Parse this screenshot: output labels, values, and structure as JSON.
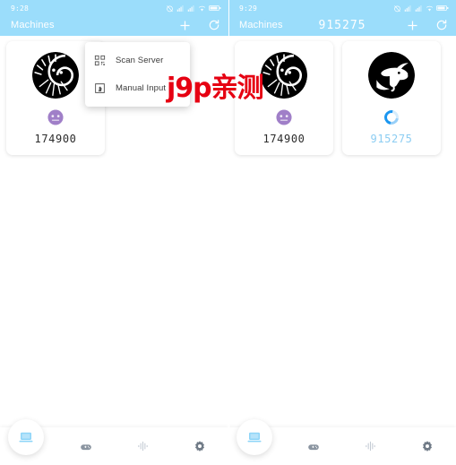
{
  "screens": [
    {
      "id": "left",
      "status": {
        "time": "9:28",
        "icons": [
          "alarm-off-icon",
          "signal-icon",
          "signal-icon",
          "wifi-icon",
          "battery-icon"
        ]
      },
      "appbar": {
        "title": "Machines",
        "code": "",
        "add_label": "+",
        "refresh_label": "↻"
      },
      "menu": {
        "visible": true,
        "items": [
          {
            "icon": "qr-scan-icon",
            "label": "Scan Server"
          },
          {
            "icon": "tap-input-icon",
            "label": "Manual Input"
          }
        ]
      },
      "cards": [
        {
          "avatar": "ammonite-cat-avatar",
          "status_icon": "purple-mini-avatar",
          "code": "174900",
          "pending": false
        }
      ]
    },
    {
      "id": "right",
      "status": {
        "time": "9:29",
        "icons": [
          "alarm-off-icon",
          "signal-icon",
          "signal-icon",
          "wifi-icon",
          "battery-icon"
        ]
      },
      "appbar": {
        "title": "Machines",
        "code": "915275",
        "add_label": "+",
        "refresh_label": "↻"
      },
      "menu": {
        "visible": false,
        "items": []
      },
      "cards": [
        {
          "avatar": "ammonite-cat-avatar",
          "status_icon": "purple-mini-avatar",
          "code": "174900",
          "pending": false
        },
        {
          "avatar": "goat-avatar",
          "status_icon": "loading-spinner",
          "code": "915275",
          "pending": true
        }
      ]
    }
  ],
  "watermark": {
    "text": "j9p亲测",
    "color": "#e60012"
  },
  "bottom_nav": {
    "items": [
      {
        "icon": "laptop-icon",
        "active": true
      },
      {
        "icon": "gamepad-icon",
        "active": false
      },
      {
        "icon": "waveform-icon",
        "active": false
      },
      {
        "icon": "gear-icon",
        "active": false
      }
    ]
  },
  "colors": {
    "header": "#9bddfb",
    "accent": "#1a96f0",
    "pending_text": "#8ccdf2",
    "background": "#ffffff",
    "watermark": "#e60012"
  }
}
